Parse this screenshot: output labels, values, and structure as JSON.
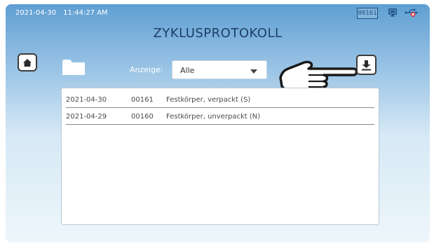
{
  "status_bar": {
    "date": "2021-04-30",
    "time": "11:44:27 AM",
    "cycle_counter": "00161"
  },
  "page": {
    "title": "ZYKLUSPROTOKOLL"
  },
  "toolbar": {
    "filter_label": "Anzeige:",
    "filter_value": "Alle",
    "home_icon": "home-icon",
    "folder_icon": "folder-icon",
    "export_icon": "download-icon",
    "pointer_icon": "pointing-hand-icon"
  },
  "log": {
    "rows": [
      {
        "date": "2021-04-30",
        "cycle": "00161",
        "program": "Festkörper, verpackt (S)"
      },
      {
        "date": "2021-04-29",
        "cycle": "00160",
        "program": "Festkörper, unverpackt (N)"
      }
    ]
  },
  "colors": {
    "title": "#1e3f66",
    "counter": "#1d4f86",
    "usb_error": "#d9232a"
  }
}
